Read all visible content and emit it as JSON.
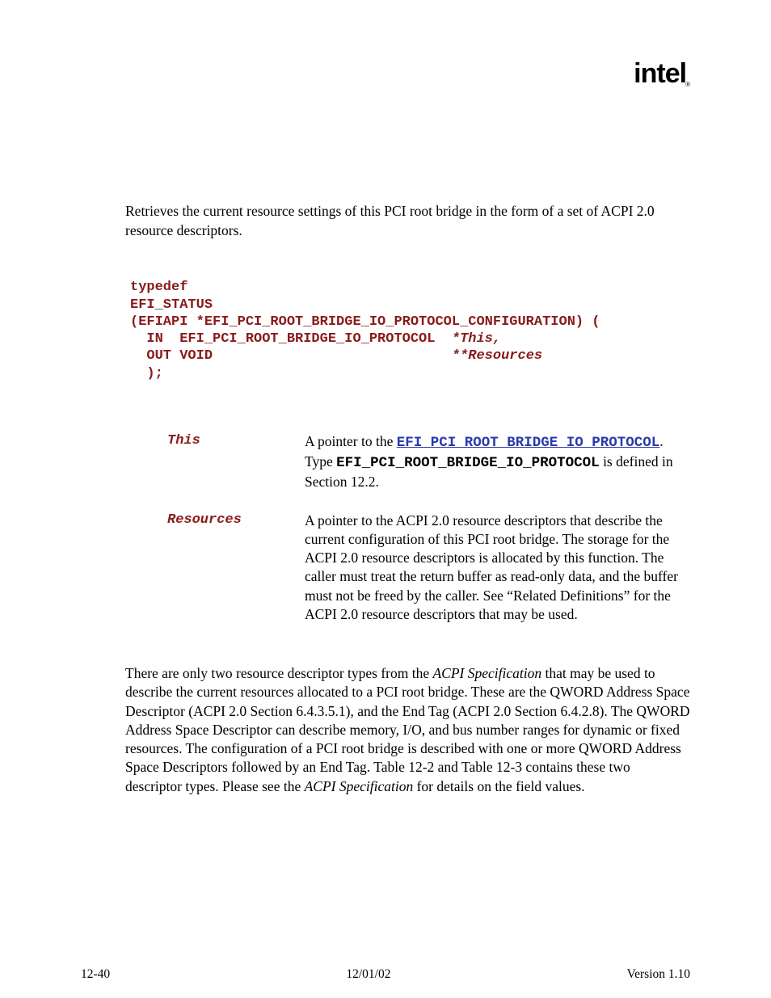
{
  "logo": "intel",
  "summary": "Retrieves the current resource settings of this PCI root bridge in the form of a set of ACPI 2.0 resource descriptors.",
  "code": {
    "l1": "typedef",
    "l2": "EFI_STATUS",
    "l3": "(EFIAPI *EFI_PCI_ROOT_BRIDGE_IO_PROTOCOL_CONFIGURATION) (",
    "l4a": "  IN  EFI_PCI_ROOT_BRIDGE_IO_PROTOCOL  ",
    "l4b": "*This,",
    "l5a": "  OUT VOID                             ",
    "l5b": "**Resources",
    "l6": "  );"
  },
  "params": {
    "p1": {
      "name": "This",
      "pre": "A pointer to the ",
      "link": "EFI_PCI_ROOT_BRIDGE_IO_PROTOCOL",
      "mid1": ". Type ",
      "plain": "EFI_PCI_ROOT_BRIDGE_IO_PROTOCOL",
      "post": " is defined in Section 12.2."
    },
    "p2": {
      "name": "Resources",
      "text": "A pointer to the ACPI 2.0 resource descriptors that describe the current configuration of this PCI root bridge.  The storage for the ACPI 2.0 resource descriptors is allocated by this function.  The caller must treat the return buffer as read-only data, and the buffer must not be freed by the caller.  See “Related Definitions” for the ACPI 2.0 resource descriptors that may be used."
    }
  },
  "desc": {
    "a": "There are only two resource descriptor types from the ",
    "i1": "ACPI Specification",
    "b": " that may be used to describe the current resources allocated to a PCI root bridge.  These are the QWORD Address Space Descriptor (ACPI 2.0 Section 6.4.3.5.1), and the End Tag (ACPI 2.0 Section 6.4.2.8).  The QWORD Address Space Descriptor can describe memory, I/O, and bus number ranges for dynamic or fixed resources.  The configuration of a PCI root bridge is described with one or more QWORD Address Space Descriptors followed by an End Tag.  Table 12-2 and Table 12-3 contains these two descriptor types.  Please see the ",
    "i2": "ACPI Specification",
    "c": " for details on the field values."
  },
  "footer": {
    "left": "12-40",
    "center": "12/01/02",
    "right": "Version 1.10"
  }
}
